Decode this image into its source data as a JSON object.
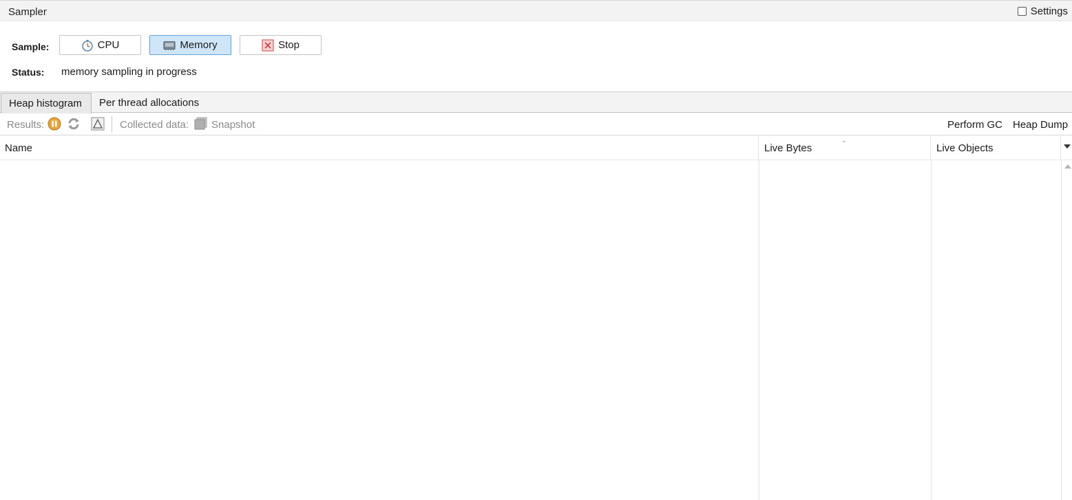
{
  "window": {
    "title": "Sampler",
    "settings_label": "Settings"
  },
  "sample": {
    "label": "Sample:",
    "buttons": [
      {
        "label": "CPU",
        "icon": "stopwatch-icon"
      },
      {
        "label": "Memory",
        "icon": "memory-chip-icon",
        "active": true
      },
      {
        "label": "Stop",
        "icon": "stop-icon"
      }
    ]
  },
  "status": {
    "label": "Status:",
    "text": "memory sampling in progress"
  },
  "tabs": [
    {
      "label": "Heap histogram",
      "active": true
    },
    {
      "label": "Per thread allocations",
      "active": false
    }
  ],
  "toolbar": {
    "results_label": "Results:",
    "collected_label": "Collected data:",
    "snapshot_label": "Snapshot",
    "perform_gc_label": "Perform GC",
    "heap_dump_label": "Heap Dump"
  },
  "table": {
    "columns": [
      "Name",
      "Live Bytes",
      "Live Objects"
    ],
    "rows": []
  },
  "colors": {
    "active_button_bg": "#cfe6f8",
    "active_button_border": "#5ea4db",
    "pause_icon": "#e8a33a",
    "stop_icon": "#e05a5a"
  }
}
